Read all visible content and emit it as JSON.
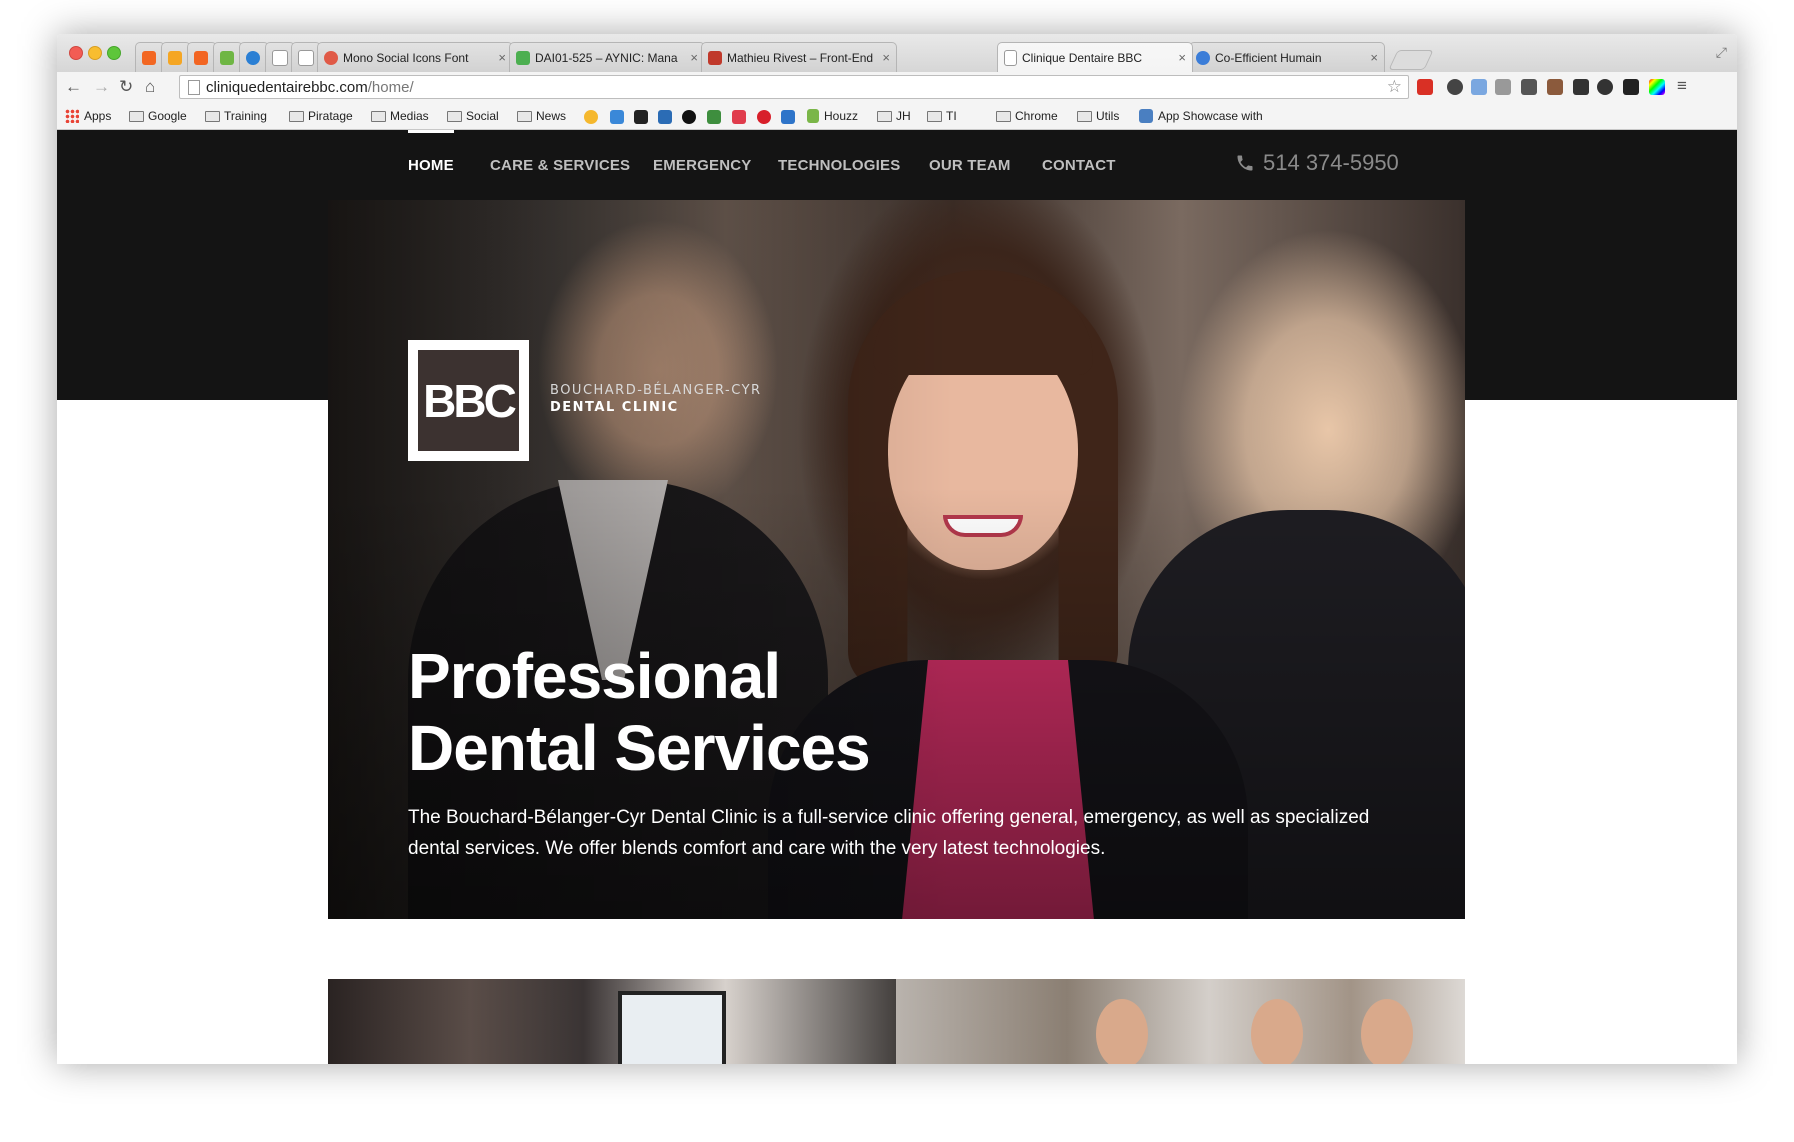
{
  "browser": {
    "tabs": [
      {
        "title": "",
        "color": "#f26722",
        "active": false
      },
      {
        "title": "",
        "color": "#f5a623",
        "active": false
      },
      {
        "title": "",
        "color": "#f26522",
        "active": false
      },
      {
        "title": "",
        "color": "#6fb644",
        "active": false
      },
      {
        "title": "",
        "color": "#2a7fd4",
        "active": false
      },
      {
        "title": "",
        "color": "#cccccc",
        "active": false
      },
      {
        "title": "",
        "color": "#cccccc",
        "active": false
      },
      {
        "title": "Mono Social Icons Font",
        "color": "#e05a47",
        "active": false
      },
      {
        "title": "DAI01-525 – AYNIC: Mana",
        "color": "#4caf50",
        "active": false
      },
      {
        "title": "Mathieu Rivest – Front-End",
        "color": "#c0392b",
        "active": false
      },
      {
        "title": "Clinique Dentaire BBC",
        "color": "#dddddd",
        "active": true
      },
      {
        "title": "Co-Efficient Humain",
        "color": "#3b7dd8",
        "active": false
      }
    ],
    "tab_close": "×",
    "url_domain": "cliniquedentairebbc.com",
    "url_path": "/home/",
    "bookmarks": [
      {
        "label": "Apps",
        "type": "apps"
      },
      {
        "label": "Google",
        "type": "folder"
      },
      {
        "label": "Training",
        "type": "folder"
      },
      {
        "label": "Piratage",
        "type": "folder"
      },
      {
        "label": "Medias",
        "type": "folder"
      },
      {
        "label": "Social",
        "type": "folder"
      },
      {
        "label": "News",
        "type": "folder"
      },
      {
        "label": "Houzz",
        "type": "site"
      },
      {
        "label": "JH",
        "type": "folder"
      },
      {
        "label": "TI",
        "type": "folder"
      },
      {
        "label": "Chrome",
        "type": "folder"
      },
      {
        "label": "Utils",
        "type": "folder"
      },
      {
        "label": "App Showcase with",
        "type": "site"
      }
    ]
  },
  "site": {
    "nav": [
      {
        "label": "HOME",
        "active": true
      },
      {
        "label": "CARE & SERVICES",
        "active": false
      },
      {
        "label": "EMERGENCY",
        "active": false
      },
      {
        "label": "TECHNOLOGIES",
        "active": false
      },
      {
        "label": "OUR TEAM",
        "active": false
      },
      {
        "label": "CONTACT",
        "active": false
      }
    ],
    "phone": "514 374-5950",
    "logo": {
      "mark": "BBC",
      "line1": "BOUCHARD-BÉLANGER-CYR",
      "line2": "DENTAL CLINIC"
    },
    "hero": {
      "title_line1": "Professional",
      "title_line2": "Dental Services",
      "text": "The Bouchard-Bélanger-Cyr Dental Clinic is a full-service clinic offering general, emergency, as well as specialized dental services. We offer blends comfort and care with the very latest technologies."
    },
    "colors": {
      "header_bg": "#141414",
      "nav_active": "#ffffff",
      "nav_inactive": "#bfbfbf",
      "phone": "#8b8b8b"
    }
  }
}
